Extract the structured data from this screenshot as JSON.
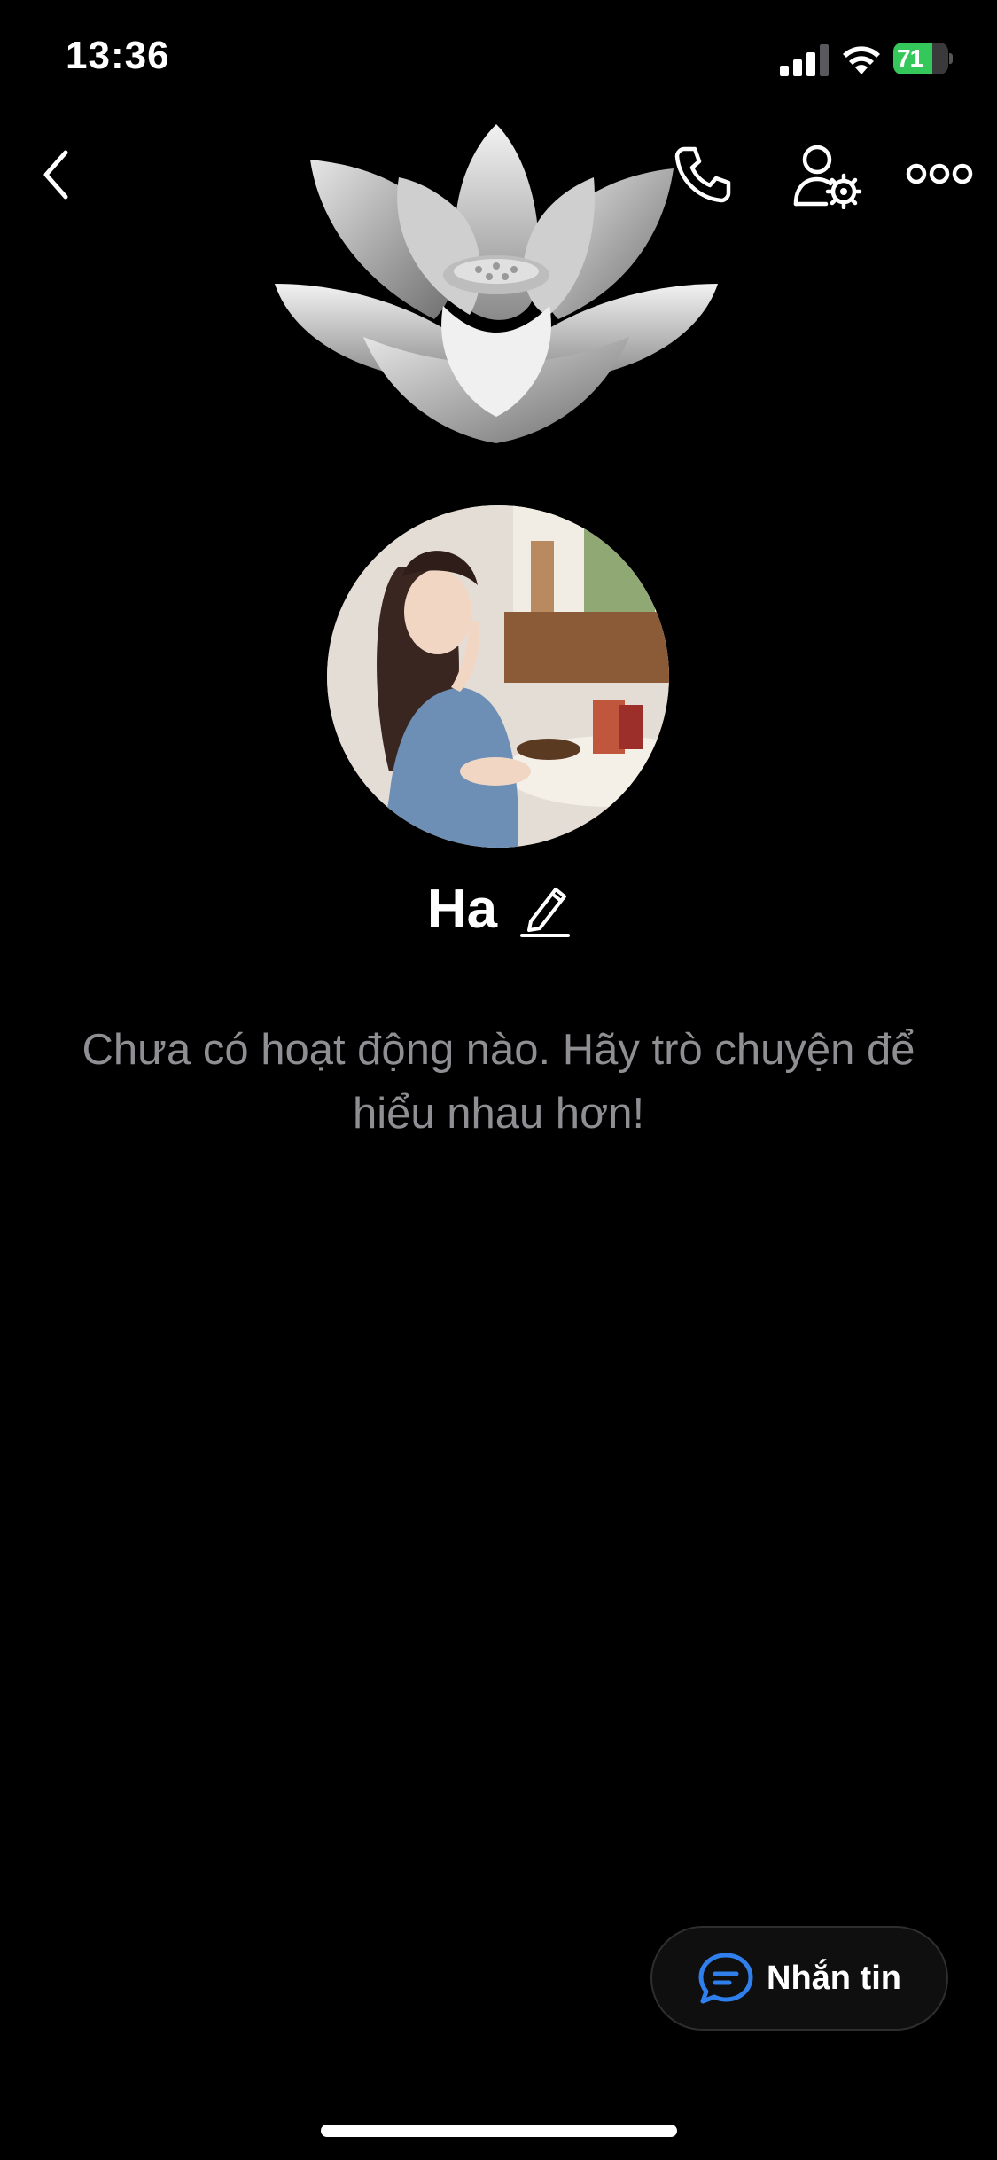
{
  "status_bar": {
    "time": "13:36",
    "battery_level": "71",
    "battery_fraction": 0.71,
    "cellular_bars": 4,
    "icons": [
      "signal-icon",
      "wifi-icon",
      "battery-charging-icon"
    ]
  },
  "header": {
    "icons": [
      "back-icon",
      "phone-icon",
      "user-settings-icon",
      "more-icon"
    ]
  },
  "profile": {
    "name": "Ha",
    "cover": "lotus-image",
    "avatar": "avatar-photo",
    "edit_icon": "pencil-icon"
  },
  "empty_state": {
    "message": "Chưa có hoạt động nào. Hãy trò chuyện để hiểu nhau hơn!"
  },
  "actions": {
    "message_button_label": "Nhắn tin",
    "message_button_icon": "chat-bubble-icon"
  },
  "colors": {
    "background": "#000000",
    "muted_text": "#8e8e93",
    "battery_green": "#34c759",
    "accent_blue": "#2f80ed"
  }
}
